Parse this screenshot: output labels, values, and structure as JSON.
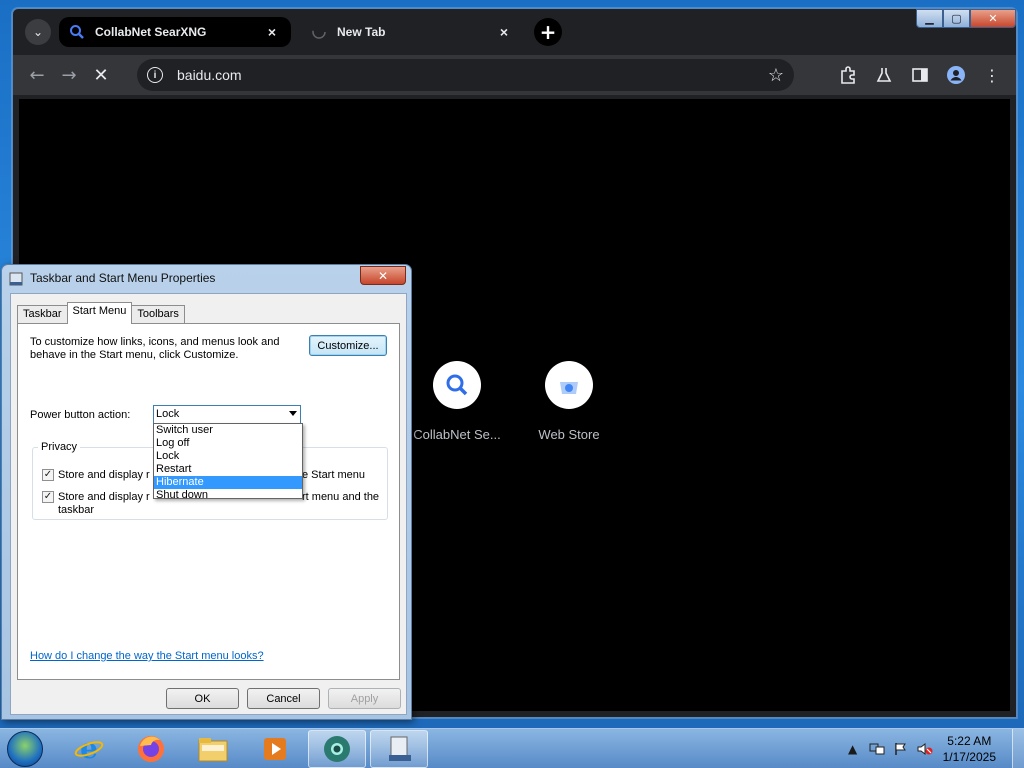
{
  "browser": {
    "tabs": [
      {
        "title": "CollabNet SearXNG",
        "active": true
      },
      {
        "title": "New Tab",
        "active": false
      }
    ],
    "tab_close": "×",
    "new_tab": "+",
    "window_controls": {
      "min": "▁",
      "max": "▢",
      "close": "✕"
    },
    "url": "baidu.com",
    "shortcuts": [
      {
        "label": "CollabNet Se...",
        "icon": "search-icon"
      },
      {
        "label": "Web Store",
        "icon": "web-store-icon"
      }
    ]
  },
  "dialog": {
    "title": "Taskbar and Start Menu Properties",
    "close_label": "✕",
    "tabs": [
      {
        "label": "Taskbar",
        "selected": false
      },
      {
        "label": "Start Menu",
        "selected": true
      },
      {
        "label": "Toolbars",
        "selected": false
      }
    ],
    "description_line1": "To customize how links, icons, and menus look and",
    "description_line2": "behave in the Start menu, click Customize.",
    "customize_label": "Customize...",
    "power_label": "Power button action:",
    "power_selected": "Lock",
    "power_options": [
      "Switch user",
      "Log off",
      "Lock",
      "Restart",
      "Hibernate",
      "Shut down"
    ],
    "power_highlighted": "Hibernate",
    "privacy_label": "Privacy",
    "privacy_option1_left": "Store and display r",
    "privacy_option1_right": "e Start menu",
    "privacy_option2_left": "Store and display r",
    "privacy_option2_right": "rt menu and the",
    "privacy_option2_line2": "taskbar",
    "help_link": "How do I change the way the Start menu looks?",
    "ok_label": "OK",
    "cancel_label": "Cancel",
    "apply_label": "Apply"
  },
  "taskbar": {
    "time": "5:22 AM",
    "date": "1/17/2025",
    "items": [
      "internet-explorer-icon",
      "firefox-icon",
      "file-explorer-icon",
      "media-player-icon",
      "chrome-browser-icon",
      "control-panel-icon"
    ]
  },
  "colors": {
    "chrome_dark": "#202124",
    "highlight": "#3399ff",
    "link": "#0066cc"
  }
}
